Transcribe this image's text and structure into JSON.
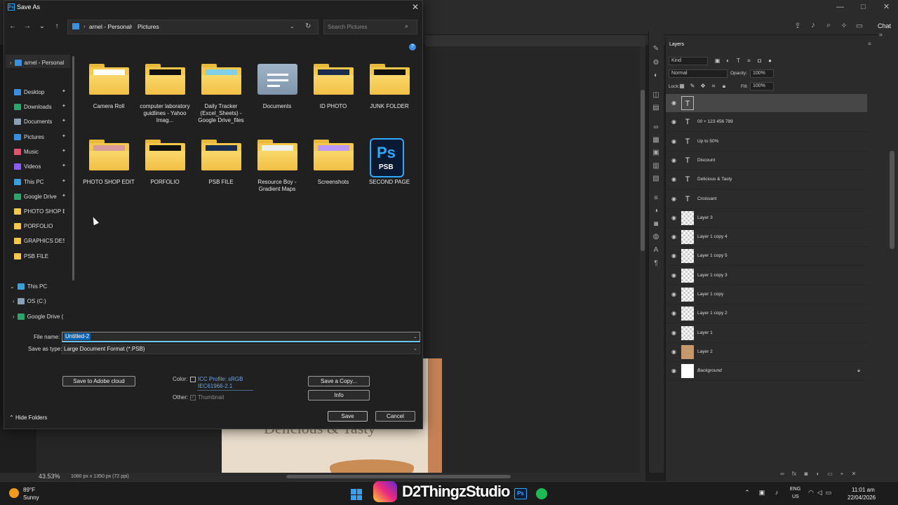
{
  "photoshop": {
    "window_controls": [
      "—",
      "□",
      "✕"
    ],
    "chat_label": "Chat",
    "zoom": "43.53%",
    "doc_size": "1080 px x 1350 px (72 ppi)",
    "image_text": "Delicious & Tasty",
    "layers": {
      "tab": "Layers",
      "kind": "Kind",
      "blend_mode": "Normal",
      "opacity_label": "Opacity:",
      "opacity": "100%",
      "lock_label": "Lock:",
      "fill_label": "Fill:",
      "fill": "100%",
      "items": [
        {
          "name": "",
          "type": "text",
          "selected": true
        },
        {
          "name": "00 + 123 456 789",
          "type": "text"
        },
        {
          "name": "Up to 50%",
          "type": "text"
        },
        {
          "name": "Discount",
          "type": "text"
        },
        {
          "name": "Delicious & Tasty",
          "type": "text"
        },
        {
          "name": "Croissant",
          "type": "text"
        },
        {
          "name": "Layer 3",
          "type": "pixel"
        },
        {
          "name": "Layer 1 copy 4",
          "type": "pixel"
        },
        {
          "name": "Layer 1 copy 5",
          "type": "pixel"
        },
        {
          "name": "Layer 1 copy 3",
          "type": "pixel"
        },
        {
          "name": "Layer 1 copy",
          "type": "pixel"
        },
        {
          "name": "Layer 1 copy 2",
          "type": "pixel"
        },
        {
          "name": "Layer 1",
          "type": "pixel"
        },
        {
          "name": "Layer 2",
          "type": "brown"
        },
        {
          "name": "Background",
          "type": "white",
          "locked": true
        }
      ]
    }
  },
  "dialog": {
    "title": "Save As",
    "address": {
      "root": "arnel - Personal",
      "folder": "Pictures"
    },
    "search_placeholder": "Search Pictures",
    "nav_items": [
      {
        "label": "arnel - Personal",
        "color": "#3a8fe0"
      },
      {
        "label": "Desktop",
        "color": "#3a8fe0",
        "pinned": true
      },
      {
        "label": "Downloads",
        "color": "#2fa36b",
        "pinned": true
      },
      {
        "label": "Documents",
        "color": "#8aa0b8",
        "pinned": true
      },
      {
        "label": "Pictures",
        "color": "#3a8fe0",
        "pinned": true
      },
      {
        "label": "Music",
        "color": "#e0556a",
        "pinned": true
      },
      {
        "label": "Videos",
        "color": "#8b5cf6",
        "pinned": true
      },
      {
        "label": "This PC",
        "color": "#3aa0d8",
        "pinned": true
      },
      {
        "label": "Google Drive",
        "color": "#2fa36b",
        "pinned": true
      },
      {
        "label": "PHOTO SHOP EI",
        "color": "#f5c84c"
      },
      {
        "label": "PORFOLIO",
        "color": "#f5c84c"
      },
      {
        "label": "GRAPHICS DESI",
        "color": "#f5c84c"
      },
      {
        "label": "PSB FILE",
        "color": "#f5c84c"
      },
      {
        "label": "This PC",
        "color": "#3aa0d8"
      },
      {
        "label": "OS (C:)",
        "color": "#8aa0b8"
      },
      {
        "label": "Google Drive (",
        "color": "#2fa36b"
      }
    ],
    "files": [
      {
        "label": "Camera Roll"
      },
      {
        "label": "computer laboratory guidlines - Yahoo Imag..."
      },
      {
        "label": "Daily Tracker (Excel_Sheets) - Google Drive_files"
      },
      {
        "label": "Documents"
      },
      {
        "label": "ID PHOTO"
      },
      {
        "label": "JUNK FOLDER"
      },
      {
        "label": "PHOTO SHOP EDIT"
      },
      {
        "label": "PORFOLIO"
      },
      {
        "label": "PSB FILE"
      },
      {
        "label": "Resource Boy - Gradient Maps"
      },
      {
        "label": "Screenshots"
      },
      {
        "label": "SECOND PAGE"
      }
    ],
    "file_name_label": "File name:",
    "file_name": "Untitled-2",
    "save_type_label": "Save as type:",
    "save_type": "Large Document Format (*.PSB)",
    "save_adobe_cloud": "Save to Adobe cloud",
    "color_label": "Color:",
    "icc_line1": "ICC Profile:  sRGB",
    "icc_line2": "IEC61966-2.1",
    "other_label": "Other:",
    "thumbnail_label": "Thumbnail",
    "save_copy": "Save a Copy...",
    "info": "Info",
    "save": "Save",
    "cancel": "Cancel",
    "hide_folders": "Hide Folders"
  },
  "taskbar": {
    "temp": "89°F",
    "weather": "Sunny",
    "watermark": "D2ThingzStudio",
    "lang1": "ENG",
    "lang2": "US",
    "time": "11:01 am",
    "date": "22/04/2026"
  }
}
